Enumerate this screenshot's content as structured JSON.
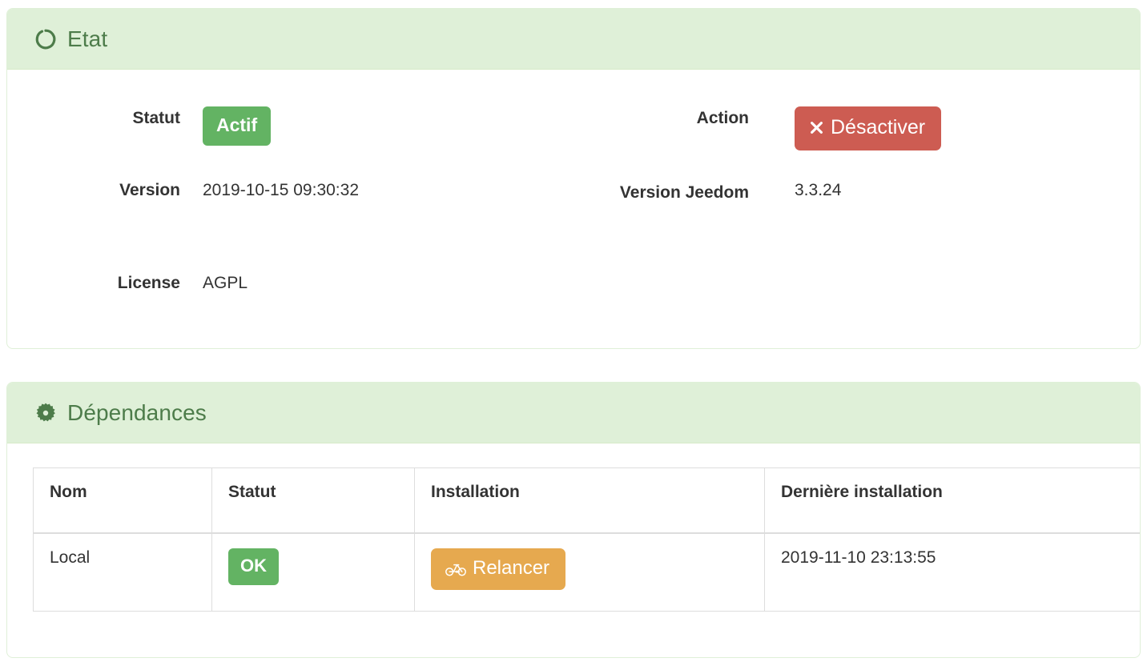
{
  "status_panel": {
    "icon": "circle-notch-icon",
    "title": "Etat",
    "fields": {
      "statut_label": "Statut",
      "statut_value": "Actif",
      "action_label": "Action",
      "action_button": "Désactiver",
      "action_button_icon": "times-icon",
      "version_label": "Version",
      "version_value": "2019-10-15 09:30:32",
      "version_jeedom_label": "Version Jeedom",
      "version_jeedom_value": "3.3.24",
      "license_label": "License",
      "license_value": "AGPL"
    }
  },
  "dependencies_panel": {
    "icon": "cog-icon",
    "title": "Dépendances",
    "table": {
      "headers": [
        "Nom",
        "Statut",
        "Installation",
        "Dernière installation"
      ],
      "rows": [
        {
          "nom": "Local",
          "statut": "OK",
          "installation_button": "Relancer",
          "installation_button_icon": "bicycle-icon",
          "derniere_installation": "2019-11-10 23:13:55"
        }
      ]
    }
  },
  "colors": {
    "panel_header_bg": "#dff0d8",
    "panel_title_text": "#4d7c4a",
    "success_green": "#63b363",
    "danger_red": "#cd5c52",
    "warning_orange": "#e6a94f",
    "table_border": "#dddddd",
    "body_text": "#333333"
  }
}
